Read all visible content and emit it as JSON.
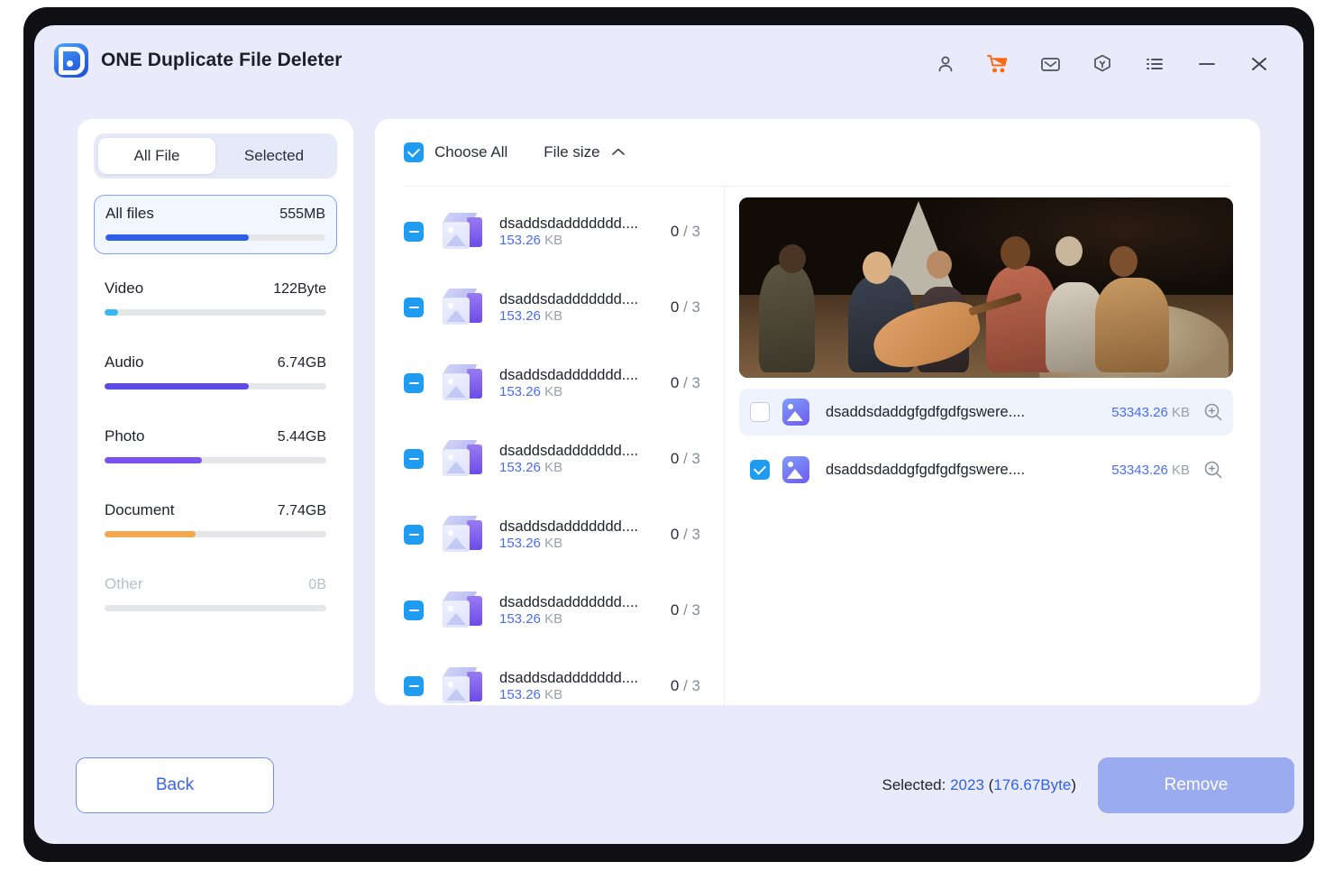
{
  "window": {
    "app_title": "ONE Duplicate File Deleter",
    "logo_icon": "app-logo-d-icon",
    "controls": [
      {
        "name": "account-icon",
        "label": "Account"
      },
      {
        "name": "cart-icon",
        "label": "Store"
      },
      {
        "name": "mail-icon",
        "label": "Feedback"
      },
      {
        "name": "shield-award-icon",
        "label": "Upgrade"
      },
      {
        "name": "menu-list-icon",
        "label": "Menu"
      },
      {
        "name": "minimize-icon",
        "label": "Minimize"
      },
      {
        "name": "close-icon",
        "label": "Close"
      }
    ],
    "accent_blue": "#2f5ee8",
    "accent_orange": "#f96a12"
  },
  "sidebar": {
    "tabs": [
      {
        "label": "All File",
        "active": true
      },
      {
        "label": "Selected",
        "active": false
      }
    ],
    "categories": [
      {
        "label": "All files",
        "size": "555MB",
        "percent": 65,
        "color": "#2f5ee8",
        "selected": true,
        "muted": false
      },
      {
        "label": "Video",
        "size": "122Byte",
        "percent": 6,
        "color": "#38b6f5",
        "selected": false,
        "muted": false
      },
      {
        "label": "Audio",
        "size": "6.74GB",
        "percent": 65,
        "color": "#5b4ae8",
        "selected": false,
        "muted": false
      },
      {
        "label": "Photo",
        "size": "5.44GB",
        "percent": 44,
        "color": "#7a52ef",
        "selected": false,
        "muted": false
      },
      {
        "label": "Document",
        "size": "7.74GB",
        "percent": 41,
        "color": "#f5a94f",
        "selected": false,
        "muted": false
      },
      {
        "label": "Other",
        "size": "0B",
        "percent": 0,
        "color": "#e4e6ea",
        "selected": false,
        "muted": true
      }
    ]
  },
  "main": {
    "choose_all_label": "Choose All",
    "choose_all_checked": true,
    "sort_label": "File size",
    "sort_direction_icon": "chevron-up-icon",
    "groups": [
      {
        "name": "dsaddsdaddddddd....",
        "size_value": "153.26",
        "size_unit": "KB",
        "count": "0",
        "count_sep": "/",
        "total": "3",
        "state": "indeterminate"
      },
      {
        "name": "dsaddsdaddddddd....",
        "size_value": "153.26",
        "size_unit": "KB",
        "count": "0",
        "count_sep": "/",
        "total": "3",
        "state": "indeterminate"
      },
      {
        "name": "dsaddsdaddddddd....",
        "size_value": "153.26",
        "size_unit": "KB",
        "count": "0",
        "count_sep": "/",
        "total": "3",
        "state": "indeterminate"
      },
      {
        "name": "dsaddsdaddddddd....",
        "size_value": "153.26",
        "size_unit": "KB",
        "count": "0",
        "count_sep": "/",
        "total": "3",
        "state": "indeterminate"
      },
      {
        "name": "dsaddsdaddddddd....",
        "size_value": "153.26",
        "size_unit": "KB",
        "count": "0",
        "count_sep": "/",
        "total": "3",
        "state": "indeterminate"
      },
      {
        "name": "dsaddsdaddddddd....",
        "size_value": "153.26",
        "size_unit": "KB",
        "count": "0",
        "count_sep": "/",
        "total": "3",
        "state": "indeterminate"
      },
      {
        "name": "dsaddsdaddddddd....",
        "size_value": "153.26",
        "size_unit": "KB",
        "count": "0",
        "count_sep": "/",
        "total": "3",
        "state": "indeterminate"
      }
    ],
    "preview": {
      "alt": "Group of friends sitting around a campfire at night, one playing an acoustic guitar in front of a lit tent"
    },
    "duplicates": [
      {
        "name": "dsaddsdaddgfgdfgdfgswere....",
        "size_value": "53343.26",
        "size_unit": "KB",
        "checked": false,
        "highlighted": true,
        "zoom_icon": "magnify-plus-icon"
      },
      {
        "name": "dsaddsdaddgfgdfgdfgswere....",
        "size_value": "53343.26",
        "size_unit": "KB",
        "checked": true,
        "highlighted": false,
        "zoom_icon": "magnify-plus-icon"
      }
    ]
  },
  "footer": {
    "back_label": "Back",
    "selected_prefix": "Selected: ",
    "selected_count": "2023",
    "selected_open": " (",
    "selected_size": "176.67Byte",
    "selected_close": ")",
    "remove_label": "Remove"
  }
}
